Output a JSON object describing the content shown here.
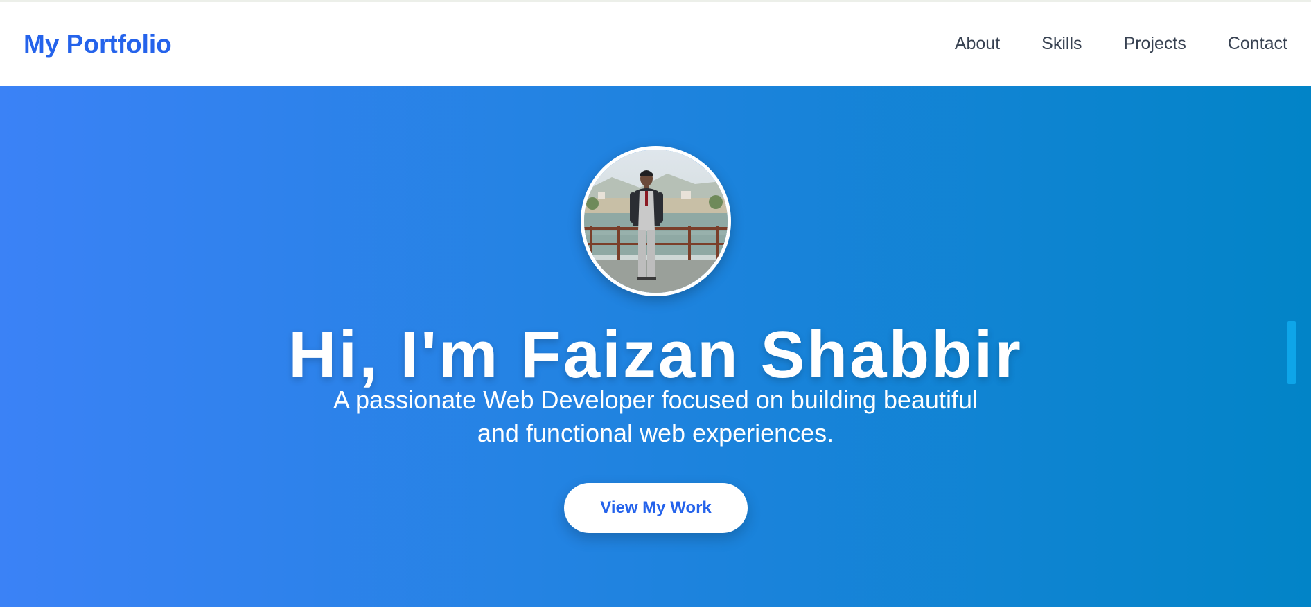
{
  "navbar": {
    "brand": "My Portfolio",
    "links": [
      "About",
      "Skills",
      "Projects",
      "Contact"
    ]
  },
  "hero": {
    "avatar_icon": "profile-photo",
    "title": "Hi, I'm Faizan Shabbir",
    "subtitle": "A passionate Web Developer focused on building beautiful and functional web experiences.",
    "cta_label": "View My Work"
  },
  "colors": {
    "brand": "#2563eb",
    "hero_gradient_start": "#3b82f6",
    "hero_gradient_end": "#0284c7",
    "nav_text": "#374151"
  }
}
